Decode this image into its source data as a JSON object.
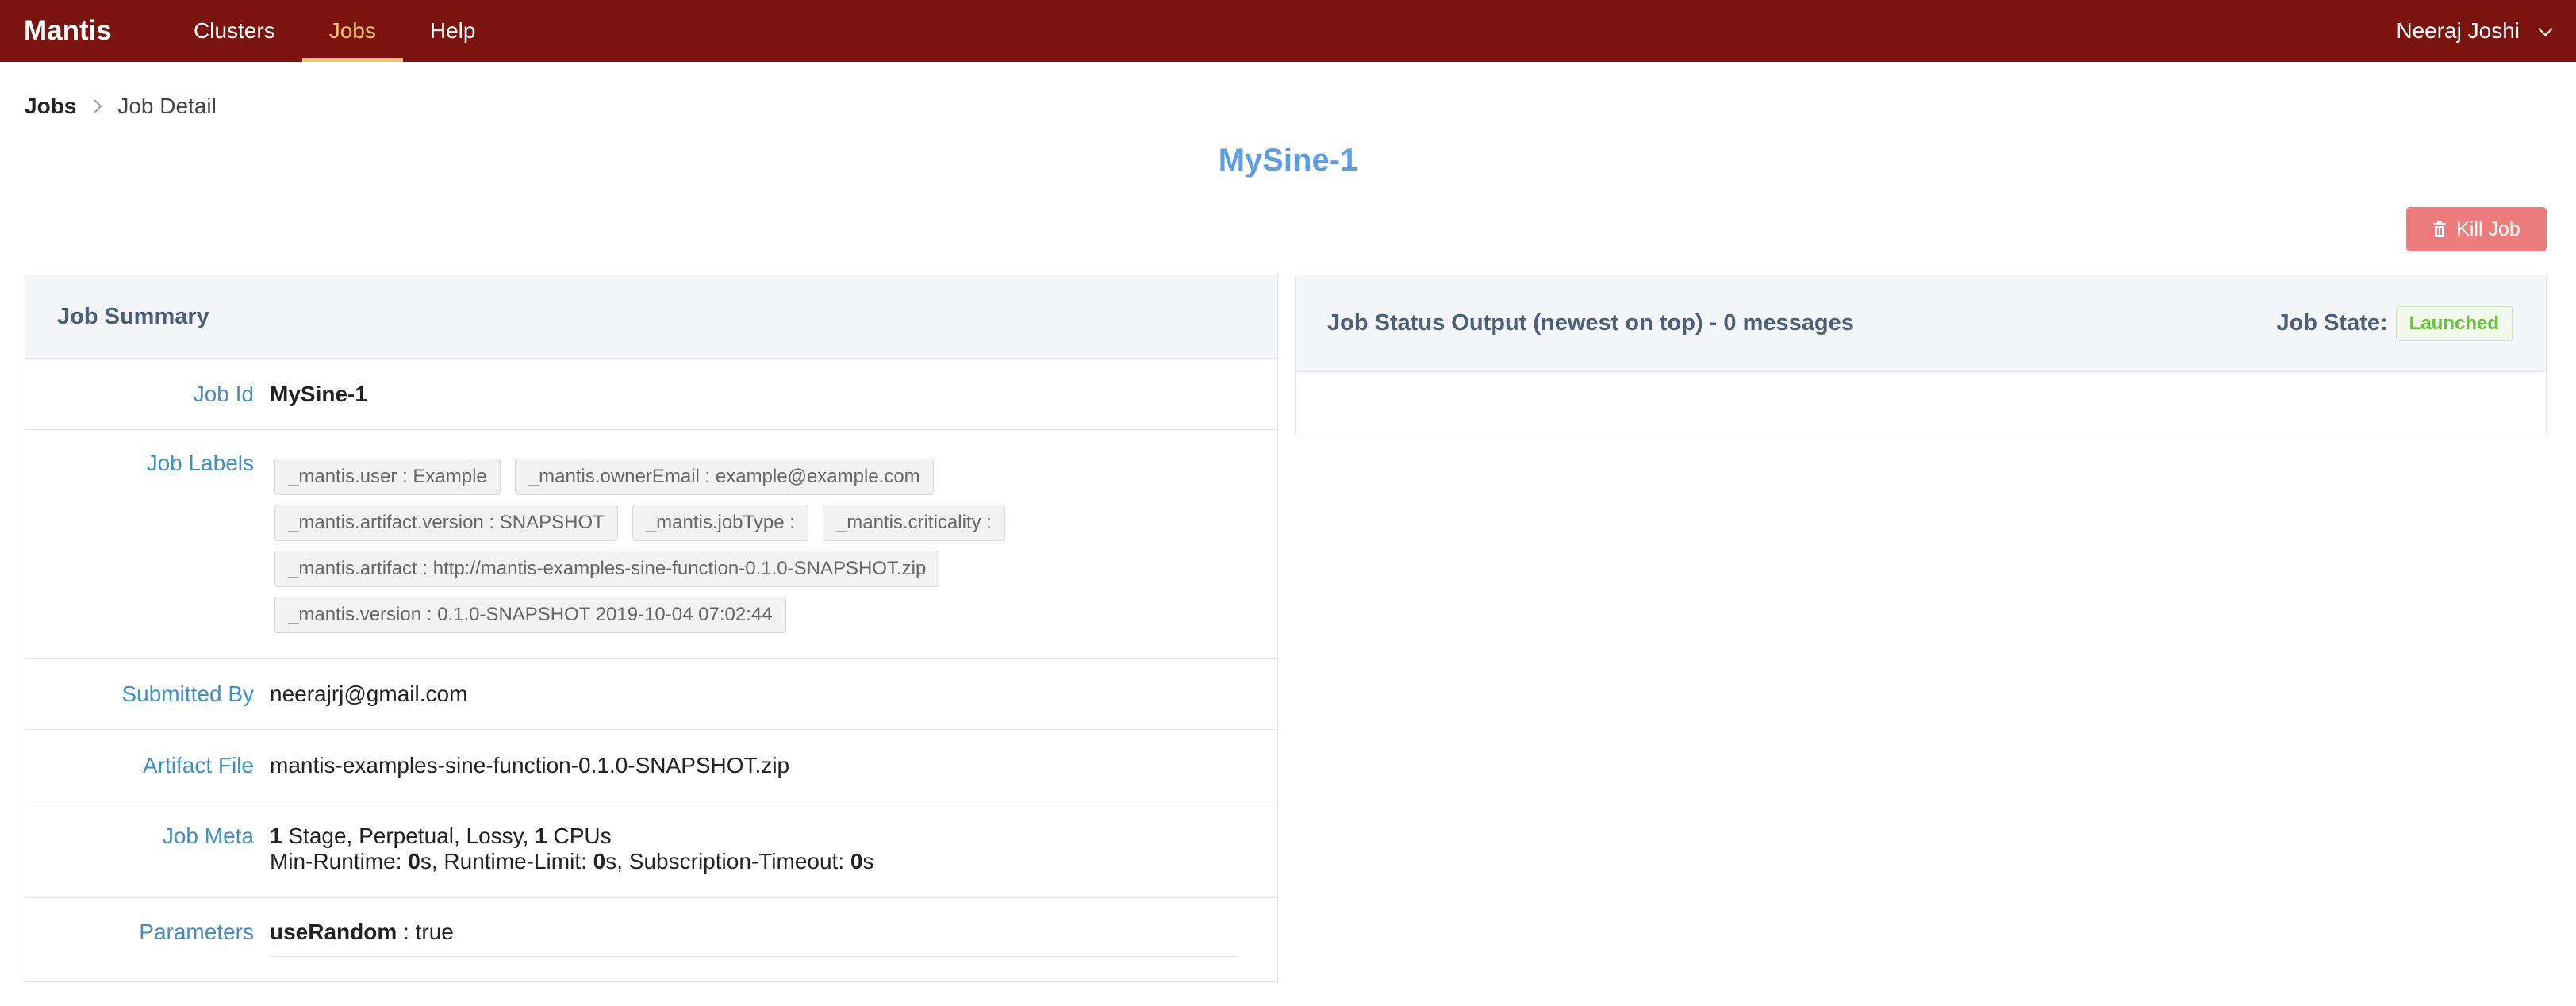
{
  "nav": {
    "brand": "Mantis",
    "items": [
      {
        "label": "Clusters"
      },
      {
        "label": "Jobs"
      },
      {
        "label": "Help"
      }
    ],
    "user": "Neeraj Joshi"
  },
  "breadcrumb": {
    "root": "Jobs",
    "current": "Job Detail"
  },
  "title": "MySine-1",
  "kill_button": "Kill Job",
  "summary": {
    "heading": "Job Summary",
    "job_id_label": "Job Id",
    "job_id": "MySine-1",
    "labels_label": "Job Labels",
    "labels": [
      "_mantis.user : Example",
      "_mantis.ownerEmail : example@example.com",
      "_mantis.artifact.version : SNAPSHOT",
      "_mantis.jobType :",
      "_mantis.criticality :",
      "_mantis.artifact : http://mantis-examples-sine-function-0.1.0-SNAPSHOT.zip",
      "_mantis.version : 0.1.0-SNAPSHOT 2019-10-04 07:02:44"
    ],
    "submitted_by_label": "Submitted By",
    "submitted_by": "neerajrj@gmail.com",
    "artifact_label": "Artifact File",
    "artifact": "mantis-examples-sine-function-0.1.0-SNAPSHOT.zip",
    "meta_label": "Job Meta",
    "meta": {
      "stages": "1",
      "stage_text": " Stage, Perpetual, Lossy, ",
      "cpus": "1",
      "cpus_text": " CPUs",
      "min_runtime_label": "Min-Runtime: ",
      "min_runtime": "0",
      "runtime_limit_label": "s, Runtime-Limit: ",
      "runtime_limit": "0",
      "sub_timeout_label": "s, Subscription-Timeout: ",
      "sub_timeout": "0",
      "suffix": "s"
    },
    "params_label": "Parameters",
    "param_key": "useRandom",
    "param_value": " : true"
  },
  "status": {
    "heading": "Job Status Output (newest on top) - 0 messages",
    "state_label": "Job State:",
    "state": "Launched"
  },
  "colors": {
    "nav_bg": "#7b130e",
    "nav_active": "#f5c46e",
    "title": "#5b9ee6",
    "kill_button": "#ed7c7c",
    "state_badge": "#67c23a"
  }
}
